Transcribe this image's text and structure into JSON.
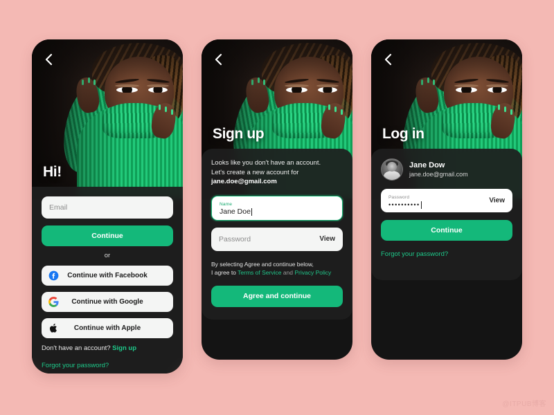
{
  "meta": {
    "background_color": "#f4b9b4",
    "accent_green": "#14b87a",
    "link_green": "#1ec98a",
    "watermark": "@ITPUB博客"
  },
  "icons": {
    "back": "chevron-left-icon",
    "facebook": "facebook-icon",
    "google": "google-icon",
    "apple": "apple-icon",
    "avatar": "user-avatar-image"
  },
  "screen1": {
    "title": "Hi!",
    "email_placeholder": "Email",
    "continue_label": "Continue",
    "divider_label": "or",
    "social_buttons": [
      {
        "label": "Continue with Facebook",
        "icon": "facebook-icon"
      },
      {
        "label": "Continue with Google",
        "icon": "google-icon"
      },
      {
        "label": "Continue with Apple",
        "icon": "apple-icon"
      }
    ],
    "signup_prompt": "Don't have an account?",
    "signup_link": "Sign up",
    "forgot_link": "Forgot your password?"
  },
  "screen2": {
    "title": "Sign up",
    "intro_line1": "Looks like you don't have an account.",
    "intro_line2": "Let's create a new account for",
    "intro_email": "jane.doe@gmail.com",
    "name_label": "Name",
    "name_value": "Jane Doe",
    "password_placeholder": "Password",
    "password_view_label": "View",
    "legal_line1": "By selecting Agree and continue below,",
    "legal_prefix": "I agree to",
    "legal_terms": "Terms of Service",
    "legal_and": "and",
    "legal_privacy": "Privacy Policy",
    "agree_label": "Agree and continue"
  },
  "screen3": {
    "title": "Log in",
    "user_name": "Jane Dow",
    "user_email": "jane.doe@gmail.com",
    "password_label": "Password",
    "password_value": "••••••••••",
    "password_view_label": "View",
    "continue_label": "Continue",
    "forgot_link": "Forgot your password?"
  }
}
